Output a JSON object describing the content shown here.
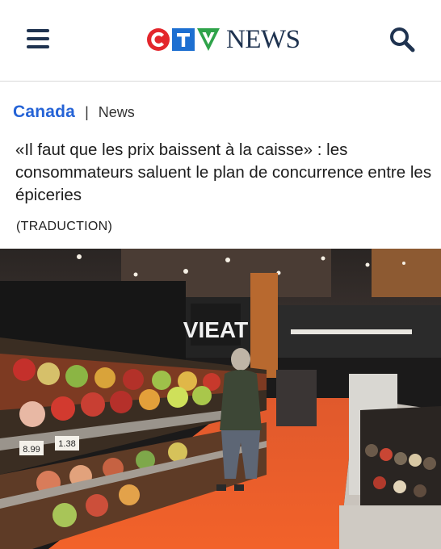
{
  "header": {
    "logo_text": "NEWS",
    "logo_letters": "CTV",
    "brand_colors": {
      "c": "#e3262c",
      "t": "#1d6fd1",
      "v": "#2fa34a",
      "navy": "#1f3350"
    },
    "menu_icon": "hamburger-icon",
    "search_icon": "search-icon"
  },
  "breadcrumb": {
    "section": "Canada",
    "separator": "|",
    "subsection": "News"
  },
  "article": {
    "headline": "«Il faut que les prix baissent à la caisse» : les consommateurs saluent le plan de concurrence entre les épiceries",
    "note": "(TRADUCTION)"
  },
  "hero_image": {
    "sign_text": "VIEAT",
    "price_tags": [
      "8.99",
      "1.38"
    ]
  }
}
